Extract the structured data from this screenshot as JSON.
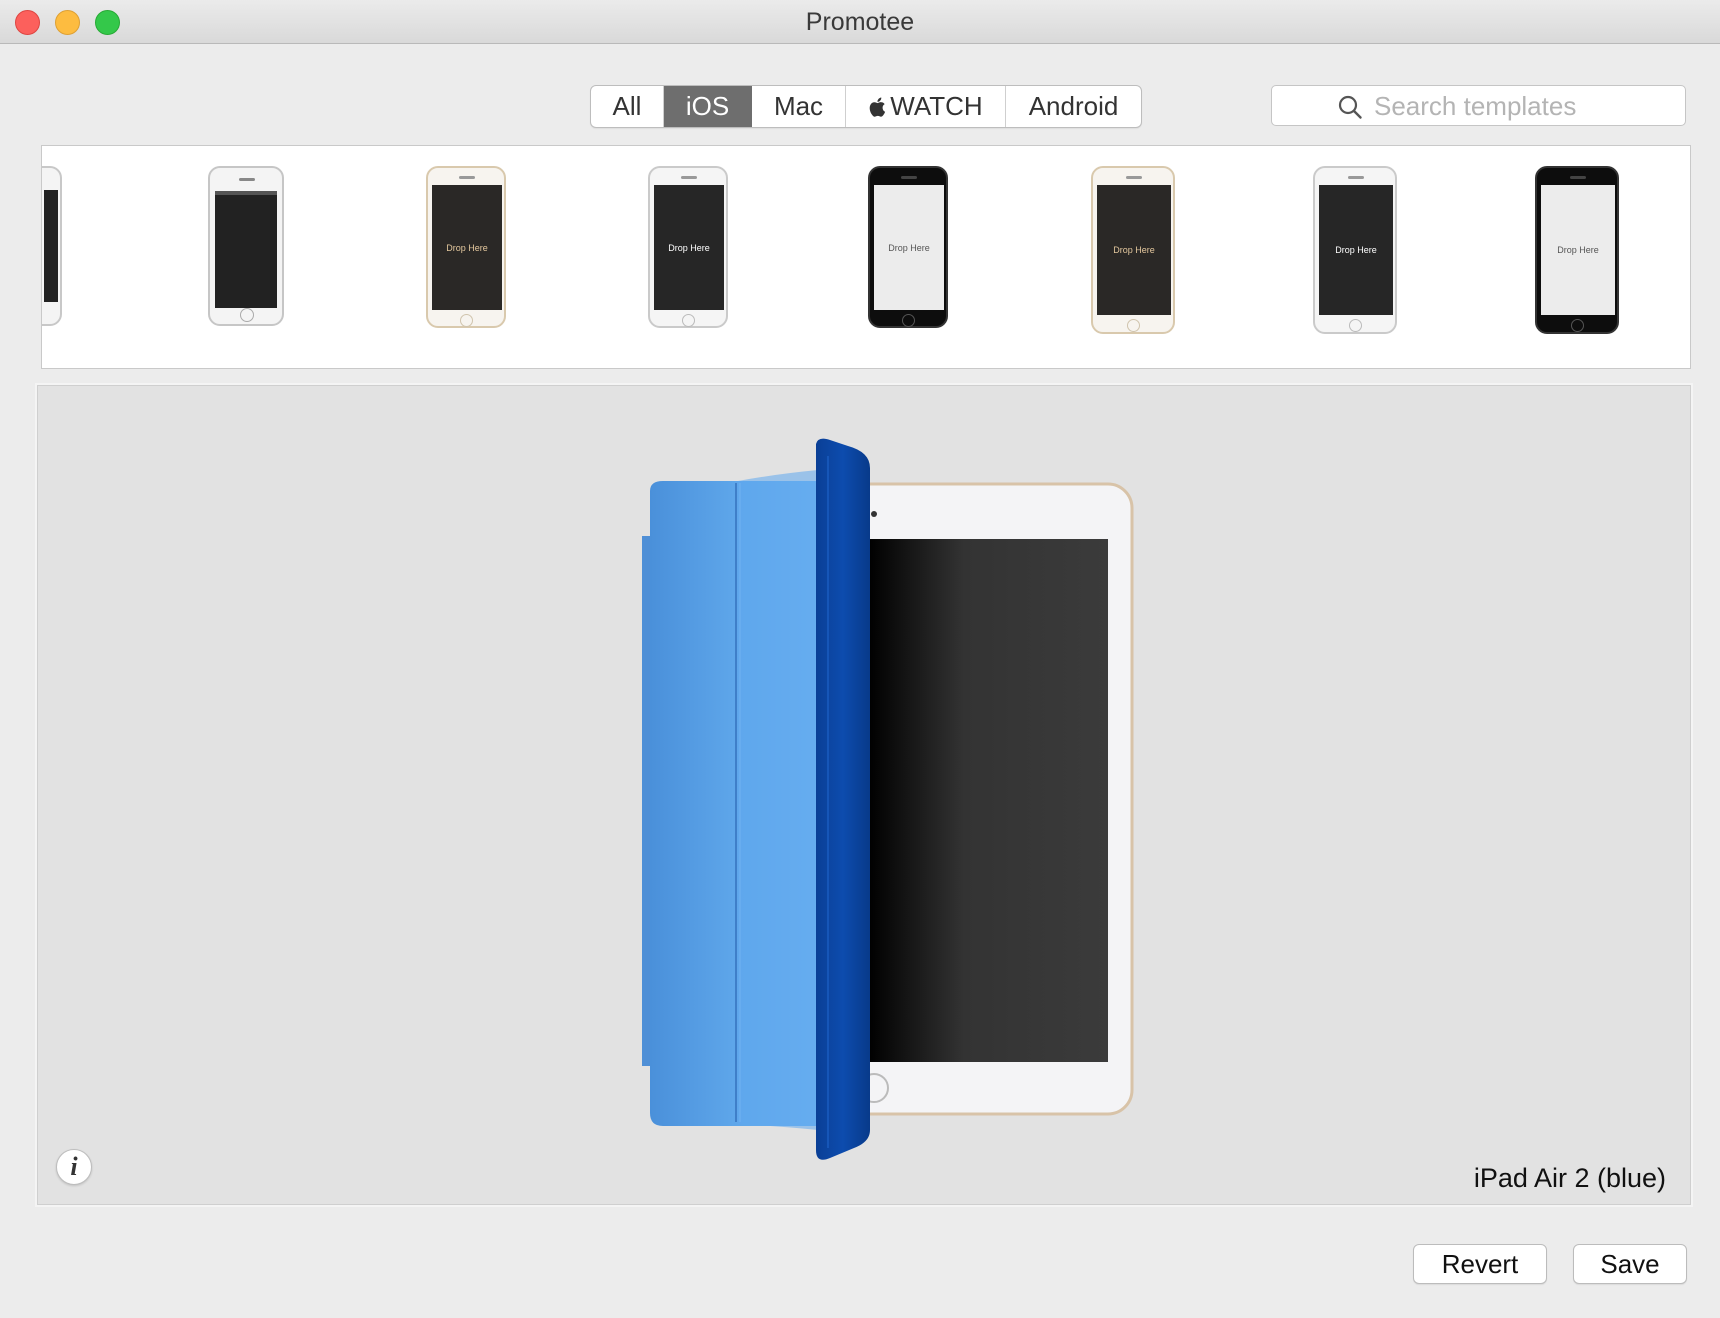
{
  "window": {
    "title": "Promotee"
  },
  "tabs": [
    {
      "label": "All",
      "active": false
    },
    {
      "label": "iOS",
      "active": true
    },
    {
      "label": "Mac",
      "active": false
    },
    {
      "label": "WATCH",
      "icon": "apple-logo-icon",
      "active": false
    },
    {
      "label": "Android",
      "active": false
    }
  ],
  "search": {
    "placeholder": "Search templates",
    "value": ""
  },
  "templates": [
    {
      "frame": "silver",
      "screen_text": ""
    },
    {
      "frame": "white",
      "screen_text": ""
    },
    {
      "frame": "gold",
      "screen_text": "Drop Here"
    },
    {
      "frame": "silver",
      "screen_text": "Drop Here"
    },
    {
      "frame": "black",
      "screen_text": "Drop Here"
    },
    {
      "frame": "gold",
      "screen_text": "Drop Here"
    },
    {
      "frame": "silver",
      "screen_text": "Drop Here"
    },
    {
      "frame": "black",
      "screen_text": "Drop Here"
    }
  ],
  "preview": {
    "device_name": "iPad Air 2 (blue)",
    "info_label": "i"
  },
  "buttons": {
    "revert": "Revert",
    "save": "Save"
  },
  "colors": {
    "active_segment": "#6e6e6e",
    "smart_cover_light": "#5aa1e6",
    "smart_cover_dark": "#0a4aa6",
    "preview_background": "#e2e2e2"
  }
}
